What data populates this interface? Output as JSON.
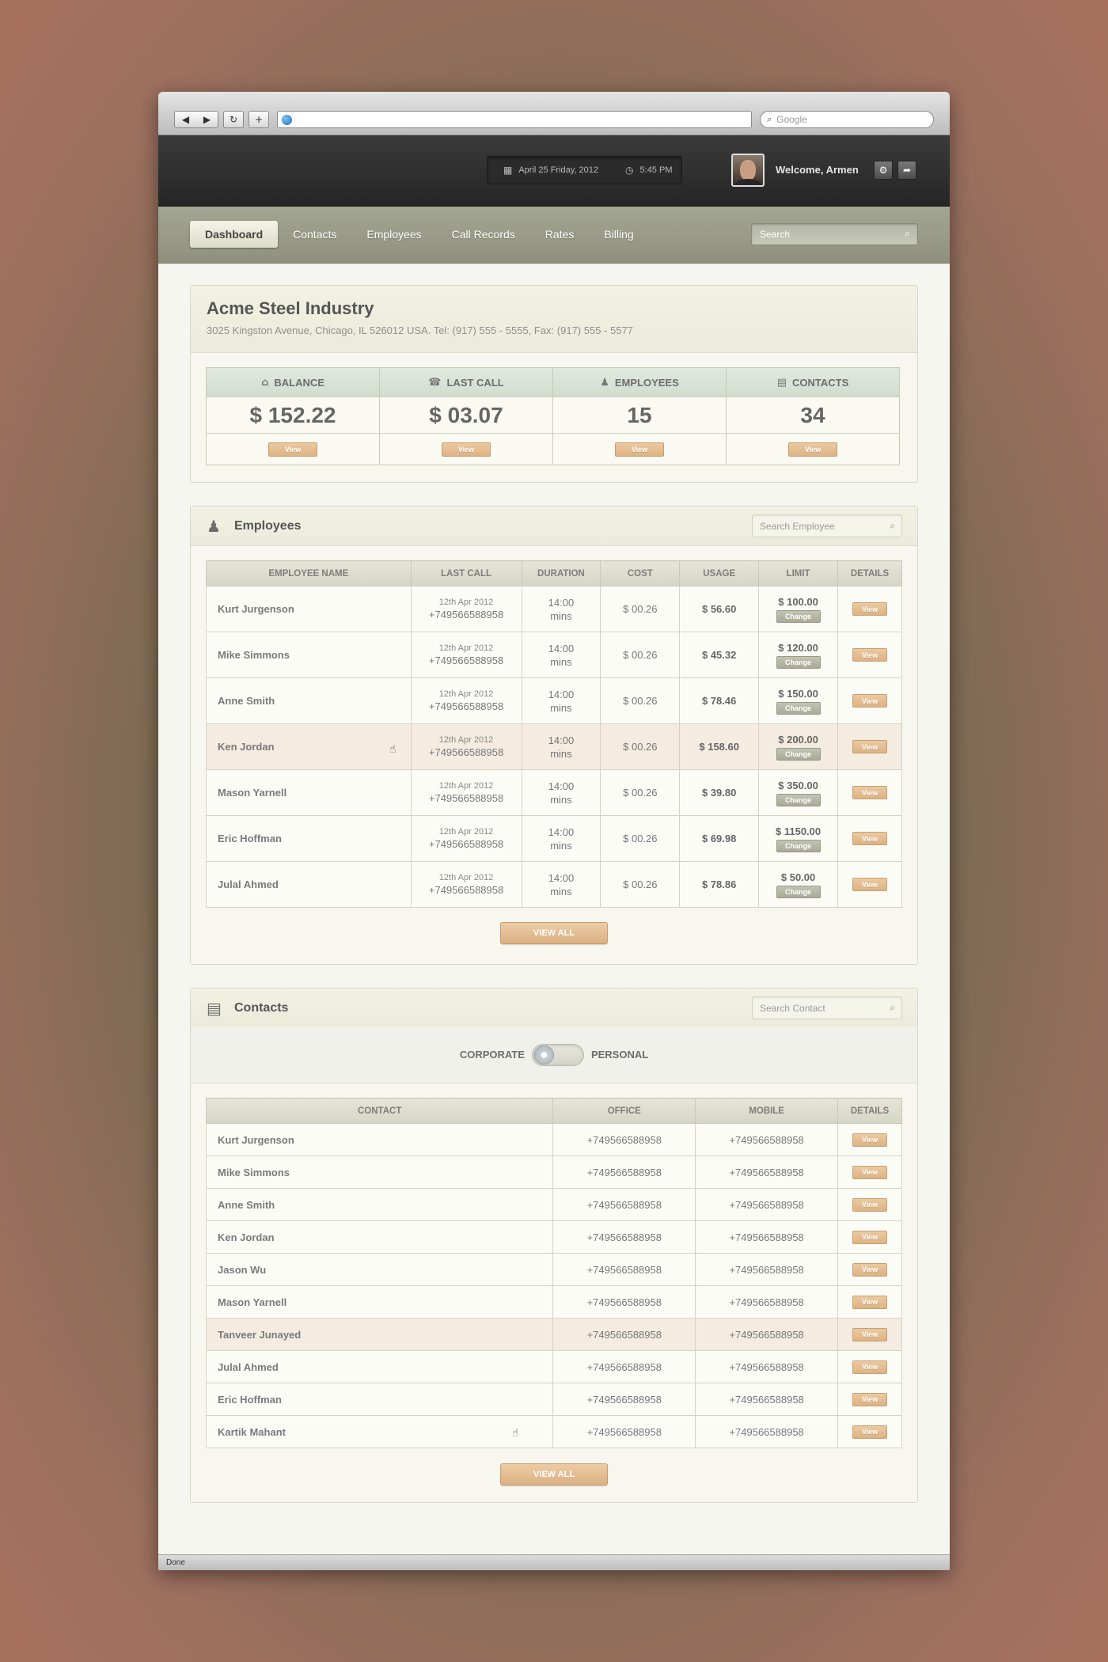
{
  "browser": {
    "search_placeholder": "Google",
    "status": "Done"
  },
  "header": {
    "date": "April 25 Friday, 2012",
    "time": "5:45 PM",
    "welcome": "Welcome, Armen"
  },
  "nav": {
    "tabs": [
      "Dashboard",
      "Contacts",
      "Employees",
      "Call Records",
      "Rates",
      "Billing"
    ],
    "active": "Dashboard",
    "search_placeholder": "Search"
  },
  "company": {
    "name": "Acme Steel Industry",
    "address": "3025 Kingston Avenue, Chicago, IL 526012 USA. Tel: (917) 555 - 5555, Fax: (917) 555 - 5577"
  },
  "stats": [
    {
      "label": "BALANCE",
      "value": "$ 152.22",
      "button": "View",
      "icon": "tag-icon"
    },
    {
      "label": "LAST CALL",
      "value": "$ 03.07",
      "button": "View",
      "icon": "phone-icon"
    },
    {
      "label": "EMPLOYEES",
      "value": "15",
      "button": "View",
      "icon": "users-icon"
    },
    {
      "label": "CONTACTS",
      "value": "34",
      "button": "View",
      "icon": "contact-card-icon"
    }
  ],
  "employees": {
    "title": "Employees",
    "search_placeholder": "Search Employee",
    "columns": [
      "EMPLOYEE NAME",
      "LAST CALL",
      "DURATION",
      "COST",
      "USAGE",
      "LIMIT",
      "DETAILS"
    ],
    "rows": [
      {
        "name": "Kurt Jurgenson",
        "date": "12th Apr 2012",
        "phone": "+749566588958",
        "duration": "14:00",
        "unit": "mins",
        "cost": "$ 00.26",
        "usage": "$ 56.60",
        "limit": "$ 100.00",
        "change": "Change",
        "view": "View"
      },
      {
        "name": "Mike Simmons",
        "date": "12th Apr 2012",
        "phone": "+749566588958",
        "duration": "14:00",
        "unit": "mins",
        "cost": "$ 00.26",
        "usage": "$ 45.32",
        "limit": "$ 120.00",
        "change": "Change",
        "view": "View"
      },
      {
        "name": "Anne Smith",
        "date": "12th Apr 2012",
        "phone": "+749566588958",
        "duration": "14:00",
        "unit": "mins",
        "cost": "$ 00.26",
        "usage": "$ 78.46",
        "limit": "$ 150.00",
        "change": "Change",
        "view": "View"
      },
      {
        "name": "Ken Jordan",
        "date": "12th Apr 2012",
        "phone": "+749566588958",
        "duration": "14:00",
        "unit": "mins",
        "cost": "$ 00.26",
        "usage": "$ 158.60",
        "limit": "$ 200.00",
        "change": "Change",
        "view": "View"
      },
      {
        "name": "Mason Yarnell",
        "date": "12th Apr 2012",
        "phone": "+749566588958",
        "duration": "14:00",
        "unit": "mins",
        "cost": "$ 00.26",
        "usage": "$ 39.80",
        "limit": "$ 350.00",
        "change": "Change",
        "view": "View"
      },
      {
        "name": "Eric Hoffman",
        "date": "12th Apr 2012",
        "phone": "+749566588958",
        "duration": "14:00",
        "unit": "mins",
        "cost": "$ 00.26",
        "usage": "$ 69.98",
        "limit": "$ 1150.00",
        "change": "Change",
        "view": "View"
      },
      {
        "name": "Julal Ahmed",
        "date": "12th Apr 2012",
        "phone": "+749566588958",
        "duration": "14:00",
        "unit": "mins",
        "cost": "$ 00.26",
        "usage": "$ 78.86",
        "limit": "$ 50.00",
        "change": "Change",
        "view": "View"
      }
    ],
    "highlighted_row": 3,
    "view_all": "VIEW ALL"
  },
  "contacts": {
    "title": "Contacts",
    "search_placeholder": "Search Contact",
    "toggle": {
      "left": "CORPORATE",
      "right": "PERSONAL"
    },
    "columns": [
      "CONTACT",
      "OFFICE",
      "MOBILE",
      "DETAILS"
    ],
    "rows": [
      {
        "name": "Kurt Jurgenson",
        "office": "+749566588958",
        "mobile": "+749566588958",
        "view": "View"
      },
      {
        "name": "Mike Simmons",
        "office": "+749566588958",
        "mobile": "+749566588958",
        "view": "View"
      },
      {
        "name": "Anne Smith",
        "office": "+749566588958",
        "mobile": "+749566588958",
        "view": "View"
      },
      {
        "name": "Ken Jordan",
        "office": "+749566588958",
        "mobile": "+749566588958",
        "view": "View"
      },
      {
        "name": "Jason Wu",
        "office": "+749566588958",
        "mobile": "+749566588958",
        "view": "View"
      },
      {
        "name": "Mason Yarnell",
        "office": "+749566588958",
        "mobile": "+749566588958",
        "view": "View"
      },
      {
        "name": "Tanveer Junayed",
        "office": "+749566588958",
        "mobile": "+749566588958",
        "view": "View"
      },
      {
        "name": "Julal Ahmed",
        "office": "+749566588958",
        "mobile": "+749566588958",
        "view": "View"
      },
      {
        "name": "Eric Hoffman",
        "office": "+749566588958",
        "mobile": "+749566588958",
        "view": "View"
      },
      {
        "name": "Kartik Mahant",
        "office": "+749566588958",
        "mobile": "+749566588958",
        "view": "View"
      }
    ],
    "highlighted_row": 6,
    "view_all": "VIEW ALL"
  }
}
